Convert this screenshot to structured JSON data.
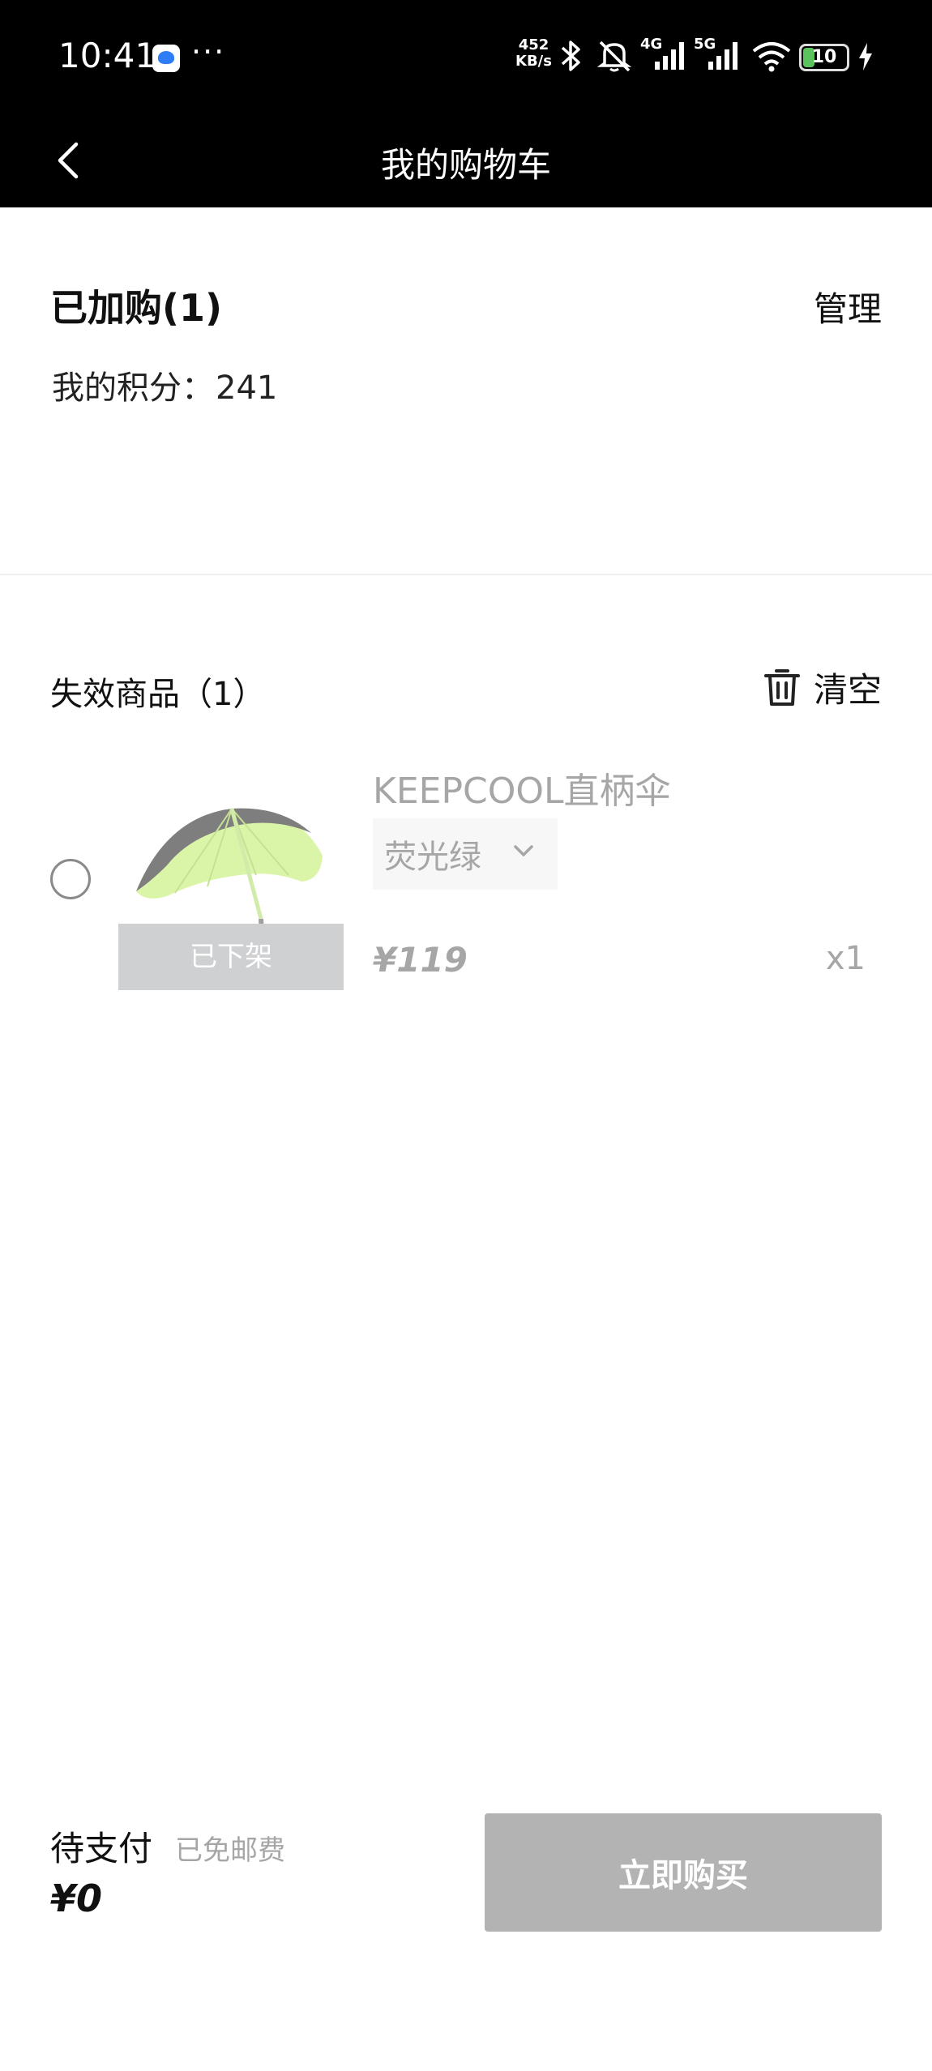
{
  "status_bar": {
    "time": "10:41",
    "more": "···",
    "net_speed_value": "452",
    "net_speed_unit": "KB/s",
    "signal_4g": "4G",
    "signal_5g": "5G",
    "battery_level": "10",
    "icons": [
      "app-notification-icon",
      "bluetooth-icon",
      "bell-muted-icon",
      "cell-signal-icon",
      "wifi-icon",
      "battery-icon",
      "charging-icon"
    ]
  },
  "nav": {
    "title": "我的购物车",
    "back_icon": "chevron-left-icon"
  },
  "cart": {
    "added_title": "已加购(1)",
    "manage_label": "管理",
    "points_label": "我的积分：",
    "points_value": "241"
  },
  "invalid": {
    "title": "失效商品（1）",
    "clear_label": "清空",
    "clear_icon": "trash-icon",
    "items": [
      {
        "name": "KEEPCOOL直柄伞",
        "variant": "荧光绿",
        "price": "¥119",
        "quantity": "x1",
        "status": "已下架",
        "image": "umbrella-image"
      }
    ]
  },
  "footer": {
    "pending_label": "待支付",
    "shipping_note": "已免邮费",
    "total": "¥0",
    "buy_label": "立即购买"
  },
  "colors": {
    "bar_background": "#000000",
    "muted_text": "#a6a6a6",
    "disabled_button": "#b3b3b3",
    "umbrella_canopy": "#c8f07a"
  }
}
